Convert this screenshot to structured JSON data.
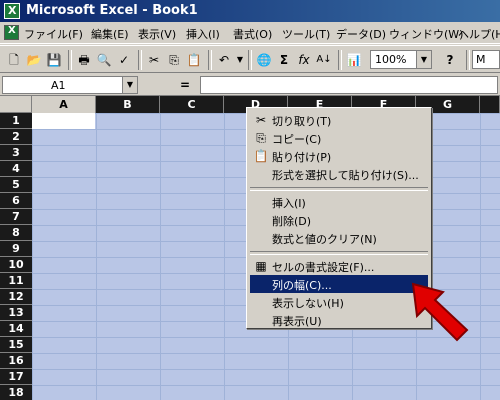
{
  "window": {
    "title": "Microsoft Excel - Book1"
  },
  "menubar": {
    "items": [
      {
        "label": "ファイル(F)"
      },
      {
        "label": "編集(E)"
      },
      {
        "label": "表示(V)"
      },
      {
        "label": "挿入(I)"
      },
      {
        "label": "書式(O)"
      },
      {
        "label": "ツール(T)"
      },
      {
        "label": "データ(D)"
      },
      {
        "label": "ウィンドウ(W)"
      },
      {
        "label": "ヘルプ(H)"
      }
    ]
  },
  "toolbar": {
    "zoom": "100%",
    "font_box": "M"
  },
  "formulabar": {
    "namebox": "A1",
    "equals": "="
  },
  "grid": {
    "columns": [
      "A",
      "B",
      "C",
      "D",
      "E",
      "F",
      "G"
    ],
    "rows": [
      "1",
      "2",
      "3",
      "4",
      "5",
      "6",
      "7",
      "8",
      "9",
      "10",
      "11",
      "12",
      "13",
      "14",
      "15",
      "16",
      "17",
      "18"
    ]
  },
  "context_menu": {
    "items": [
      {
        "label": "切り取り(T)",
        "icon": "scissors-icon"
      },
      {
        "label": "コピー(C)",
        "icon": "copy-icon"
      },
      {
        "label": "貼り付け(P)",
        "icon": "paste-icon"
      },
      {
        "label": "形式を選択して貼り付け(S)...",
        "icon": ""
      },
      {
        "label": "挿入(I)",
        "icon": ""
      },
      {
        "label": "削除(D)",
        "icon": ""
      },
      {
        "label": "数式と値のクリア(N)",
        "icon": ""
      },
      {
        "label": "セルの書式設定(F)...",
        "icon": "format-cells-icon"
      },
      {
        "label": "列の幅(C)...",
        "icon": ""
      },
      {
        "label": "表示しない(H)",
        "icon": ""
      },
      {
        "label": "再表示(U)",
        "icon": ""
      }
    ],
    "highlighted": "列の幅(C)..."
  },
  "colors": {
    "titlebar": "#0a246a",
    "highlight": "#0a246a",
    "selection": "#b9c6e6",
    "arrow": "#e00000"
  }
}
